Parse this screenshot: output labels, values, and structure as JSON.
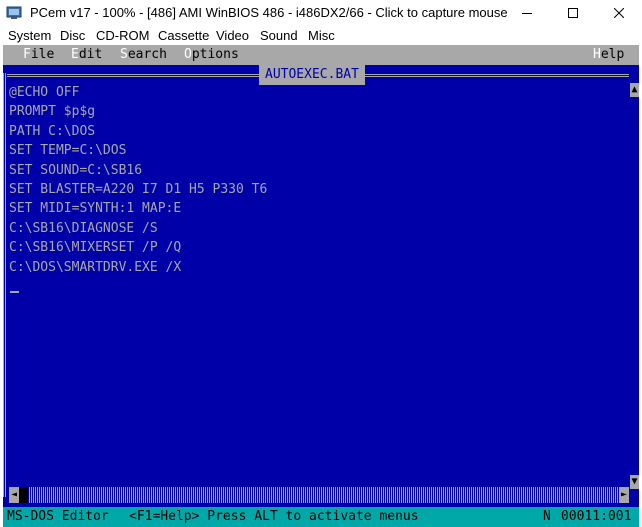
{
  "window": {
    "title": "PCem v17 - 100% - [486] AMI WinBIOS 486 - i486DX2/66 - Click to capture mouse",
    "controls": [
      "minimize",
      "maximize",
      "close"
    ]
  },
  "emulator_menu": [
    "System",
    "Disc",
    "CD-ROM",
    "Cassette",
    "Video",
    "Sound",
    "Misc"
  ],
  "dos_menu": {
    "file": {
      "hot": "F",
      "rest": "ile"
    },
    "edit": {
      "hot": "E",
      "rest": "dit"
    },
    "search": {
      "hot": "S",
      "rest": "earch"
    },
    "options": {
      "hot": "O",
      "rest": "ptions"
    },
    "help": {
      "hot": "H",
      "rest": "elp"
    }
  },
  "editor": {
    "filename": "AUTOEXEC.BAT",
    "lines": [
      "@ECHO OFF",
      "PROMPT $p$g",
      "PATH C:\\DOS",
      "SET TEMP=C:\\DOS",
      "SET SOUND=C:\\SB16",
      "SET BLASTER=A220 I7 D1 H5 P330 T6",
      "SET MIDI=SYNTH:1 MAP:E",
      "C:\\SB16\\DIAGNOSE /S",
      "C:\\SB16\\MIXERSET /P /Q",
      "C:\\DOS\\SMARTDRV.EXE /X"
    ]
  },
  "status": {
    "app": "MS-DOS Editor",
    "hint": "<F1=Help> Press ALT to activate menus",
    "mode": "N",
    "position": "00011:001"
  },
  "colors": {
    "dos_blue": "#0000a8",
    "dos_gray": "#a8a8a8",
    "status_cyan": "#00a8a8"
  }
}
